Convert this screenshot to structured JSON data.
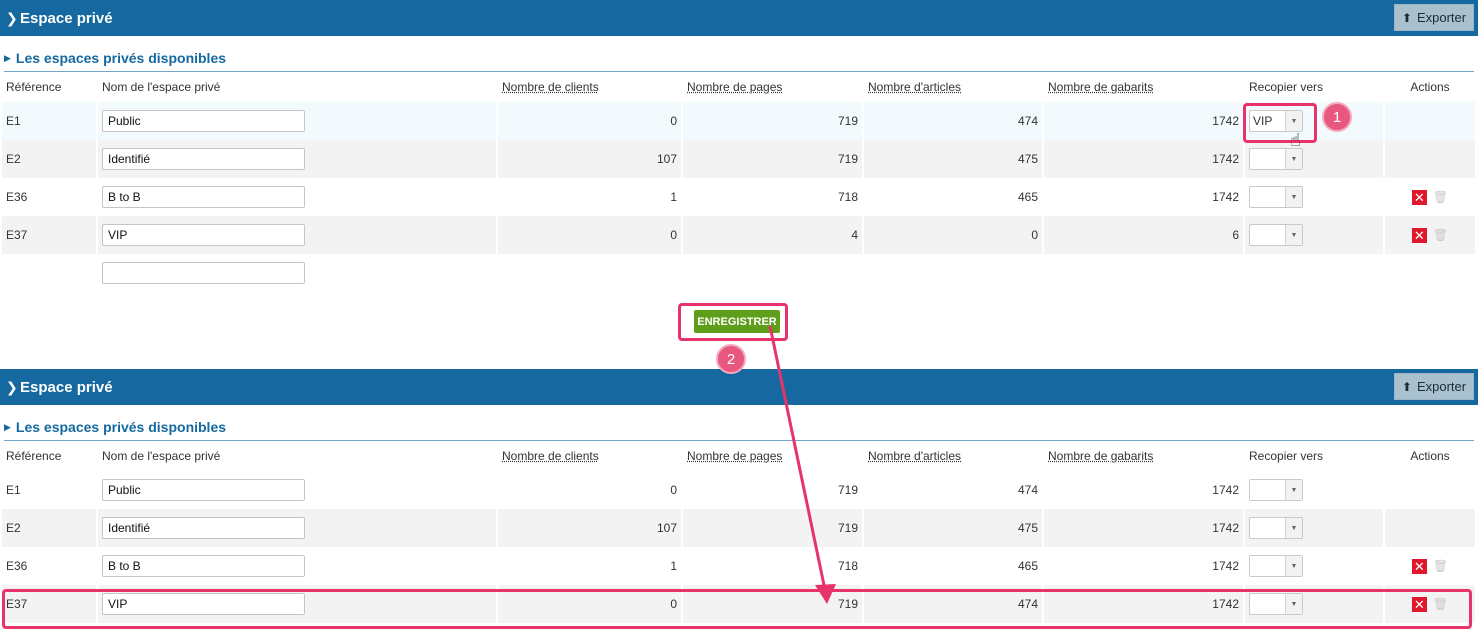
{
  "panel_top": {
    "header_title": "Espace privé",
    "export_label": "Exporter",
    "section_title": "Les espaces privés disponibles",
    "columns": [
      "Référence",
      "Nom de l'espace privé",
      "Nombre de clients",
      "Nombre de pages",
      "Nombre d'articles",
      "Nombre de gabarits",
      "Recopier vers",
      "Actions"
    ],
    "rows": [
      {
        "ref": "E1",
        "name": "Public",
        "clients": "0",
        "pages": "719",
        "articles": "474",
        "gabarits": "1742",
        "copy": "VIP"
      },
      {
        "ref": "E2",
        "name": "Identifié",
        "clients": "107",
        "pages": "719",
        "articles": "475",
        "gabarits": "1742",
        "copy": ""
      },
      {
        "ref": "E36",
        "name": "B to B",
        "clients": "1",
        "pages": "718",
        "articles": "465",
        "gabarits": "1742",
        "copy": ""
      },
      {
        "ref": "E37",
        "name": "VIP",
        "clients": "0",
        "pages": "4",
        "articles": "0",
        "gabarits": "6",
        "copy": ""
      }
    ],
    "save_label": "ENREGISTRER"
  },
  "panel_bottom": {
    "header_title": "Espace privé",
    "export_label": "Exporter",
    "section_title": "Les espaces privés disponibles",
    "columns": [
      "Référence",
      "Nom de l'espace privé",
      "Nombre de clients",
      "Nombre de pages",
      "Nombre d'articles",
      "Nombre de gabarits",
      "Recopier vers",
      "Actions"
    ],
    "rows": [
      {
        "ref": "E1",
        "name": "Public",
        "clients": "0",
        "pages": "719",
        "articles": "474",
        "gabarits": "1742",
        "copy": ""
      },
      {
        "ref": "E2",
        "name": "Identifié",
        "clients": "107",
        "pages": "719",
        "articles": "475",
        "gabarits": "1742",
        "copy": ""
      },
      {
        "ref": "E36",
        "name": "B to B",
        "clients": "1",
        "pages": "718",
        "articles": "465",
        "gabarits": "1742",
        "copy": ""
      },
      {
        "ref": "E37",
        "name": "VIP",
        "clients": "0",
        "pages": "719",
        "articles": "474",
        "gabarits": "1742",
        "copy": ""
      }
    ]
  },
  "annotations": {
    "step1": "1",
    "step2": "2"
  },
  "colors": {
    "header": "#1569a0",
    "save": "#5f9e1a",
    "highlight": "#e8336a",
    "delete": "#e0182d"
  },
  "icons": {
    "chevron": "chevron-right-icon",
    "export": "upload-icon",
    "delete": "delete-x-icon",
    "trash": "trash-icon",
    "dropdown": "dropdown-arrow-icon"
  }
}
